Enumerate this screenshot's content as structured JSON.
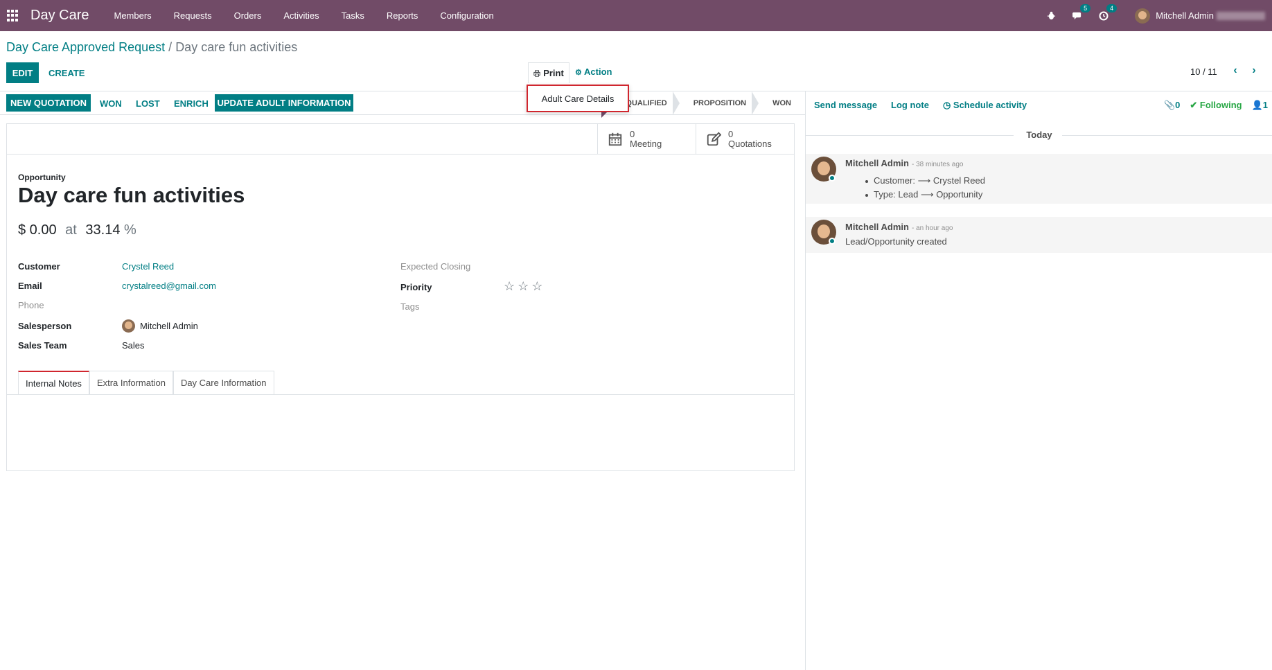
{
  "navbar": {
    "app_name": "Day Care",
    "menu": [
      "Members",
      "Requests",
      "Orders",
      "Activities",
      "Tasks",
      "Reports",
      "Configuration"
    ],
    "messages_count": "5",
    "activities_count": "4",
    "user_name": "Mitchell Admin",
    "color": "#714B67"
  },
  "breadcrumb": {
    "parent": "Day Care Approved Request",
    "separator": "/",
    "current": "Day care fun activities"
  },
  "toolbar": {
    "edit": "EDIT",
    "create": "CREATE",
    "print": "Print",
    "action": "Action",
    "print_menu_item": "Adult Care Details",
    "pager": "10 / 11"
  },
  "statusbar": {
    "buttons": [
      "NEW QUOTATION",
      "WON",
      "LOST",
      "ENRICH",
      "UPDATE ADULT INFORMATION"
    ],
    "stages": [
      "QUALIFIED",
      "PROPOSITION",
      "WON"
    ]
  },
  "smart_buttons": {
    "meeting_count": "0",
    "meeting_label": "Meeting",
    "quotation_count": "0",
    "quotation_label": "Quotations"
  },
  "record": {
    "type_label": "Opportunity",
    "name": "Day care fun activities",
    "revenue": "$ 0.00",
    "at": "at",
    "probability": "33.14",
    "percent": "%",
    "fields_left": {
      "customer_label": "Customer",
      "customer": "Crystel Reed",
      "email_label": "Email",
      "email": "crystalreed@gmail.com",
      "phone_label": "Phone",
      "salesperson_label": "Salesperson",
      "salesperson": "Mitchell Admin",
      "team_label": "Sales Team",
      "team": "Sales"
    },
    "fields_right": {
      "closing_label": "Expected Closing",
      "priority_label": "Priority",
      "priority_stars": 0,
      "tags_label": "Tags"
    }
  },
  "tabs": [
    "Internal Notes",
    "Extra Information",
    "Day Care Information"
  ],
  "chatter": {
    "send_message": "Send message",
    "log_note": "Log note",
    "schedule_activity": "Schedule activity",
    "attachments": "0",
    "following": "Following",
    "followers": "1",
    "today": "Today",
    "messages": [
      {
        "author": "Mitchell Admin",
        "date": "- 38 minutes ago",
        "lines": [
          "Customer: ⟶ Crystel Reed",
          "Type: Lead ⟶ Opportunity"
        ]
      },
      {
        "author": "Mitchell Admin",
        "date": "- an hour ago",
        "body": "Lead/Opportunity created"
      }
    ]
  }
}
